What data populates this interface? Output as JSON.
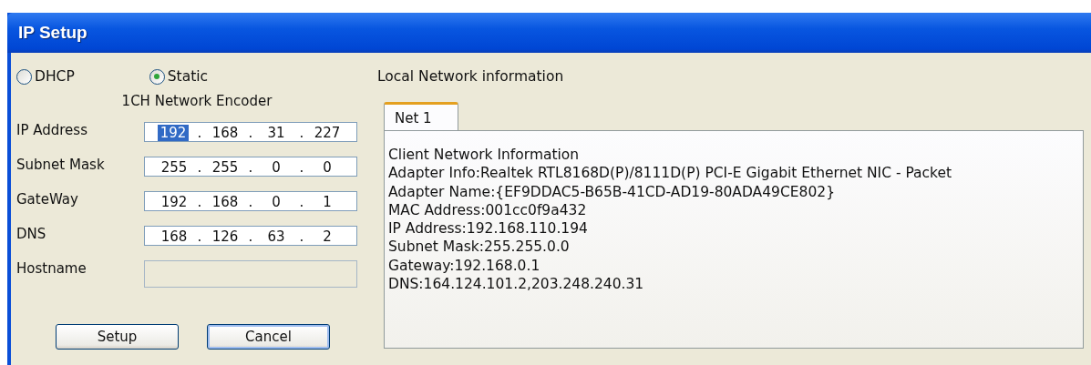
{
  "window": {
    "title": "IP Setup"
  },
  "mode_options": [
    {
      "label": "DHCP",
      "selected": false
    },
    {
      "label": "Static",
      "selected": true
    }
  ],
  "device_name": "1CH Network Encoder",
  "octet_separator": ".",
  "fields": [
    {
      "label": "IP Address",
      "disabled": false,
      "octets": [
        {
          "value": "192",
          "selected": true
        },
        {
          "value": "168",
          "selected": false
        },
        {
          "value": "31",
          "selected": false
        },
        {
          "value": "227",
          "selected": false
        }
      ]
    },
    {
      "label": "Subnet Mask",
      "disabled": false,
      "octets": [
        {
          "value": "255",
          "selected": false
        },
        {
          "value": "255",
          "selected": false
        },
        {
          "value": "0",
          "selected": false
        },
        {
          "value": "0",
          "selected": false
        }
      ]
    },
    {
      "label": "GateWay",
      "disabled": false,
      "octets": [
        {
          "value": "192",
          "selected": false
        },
        {
          "value": "168",
          "selected": false
        },
        {
          "value": "0",
          "selected": false
        },
        {
          "value": "1",
          "selected": false
        }
      ]
    },
    {
      "label": "DNS",
      "disabled": false,
      "octets": [
        {
          "value": "168",
          "selected": false
        },
        {
          "value": "126",
          "selected": false
        },
        {
          "value": "63",
          "selected": false
        },
        {
          "value": "2",
          "selected": false
        }
      ]
    },
    {
      "label": "Hostname",
      "disabled": true
    }
  ],
  "buttons": [
    "Setup",
    "Cancel"
  ],
  "local_network": {
    "heading": "Local Network information",
    "tabs": [
      {
        "label": "Net 1",
        "selected": true
      }
    ],
    "lines": [
      "Client Network Information",
      "Adapter Info:Realtek RTL8168D(P)/8111D(P) PCI-E Gigabit Ethernet NIC - Packet",
      "Adapter Name:{EF9DDAC5-B65B-41CD-AD19-80ADA49CE802}",
      "MAC Address:001cc0f9a432",
      "IP Address:192.168.110.194",
      "Subnet Mask:255.255.0.0",
      "Gateway:192.168.0.1",
      "DNS:164.124.101.2,203.248.240.31"
    ]
  }
}
